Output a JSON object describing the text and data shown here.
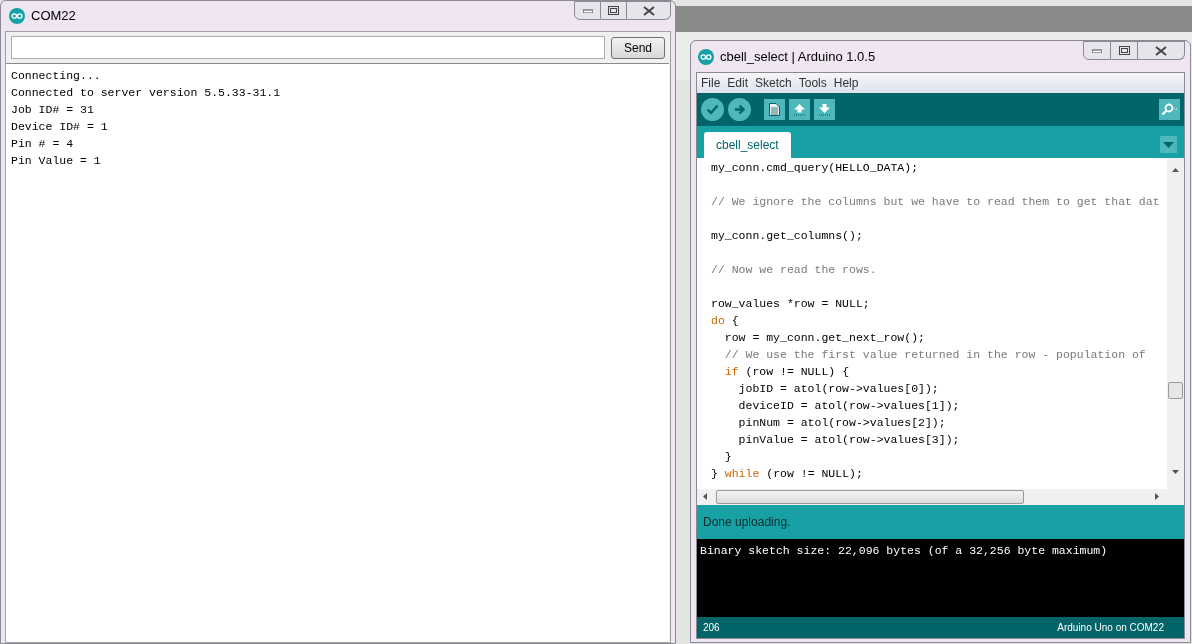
{
  "serial_monitor": {
    "title": "COM22",
    "send_button": "Send",
    "output_lines": [
      "Connecting...",
      "Connected to server version 5.5.33-31.1",
      "Job ID# = 31",
      "Device ID# = 1",
      "Pin # = 4",
      "Pin Value = 1"
    ]
  },
  "ide": {
    "title": "cbell_select | Arduino 1.0.5",
    "menu": [
      "File",
      "Edit",
      "Sketch",
      "Tools",
      "Help"
    ],
    "tabs": [
      {
        "label": "cbell_select",
        "selected": true
      }
    ],
    "code_lines": [
      {
        "kind": "code",
        "segments": [
          {
            "kind": "plain",
            "text": "my_conn.cmd_query(HELLO_DATA);"
          }
        ]
      },
      {
        "kind": "blank"
      },
      {
        "kind": "code",
        "segments": [
          {
            "kind": "comment",
            "text": "// We ignore the columns but we have to read them to get that dat"
          }
        ]
      },
      {
        "kind": "blank"
      },
      {
        "kind": "code",
        "segments": [
          {
            "kind": "plain",
            "text": "my_conn.get_columns();"
          }
        ]
      },
      {
        "kind": "blank"
      },
      {
        "kind": "code",
        "segments": [
          {
            "kind": "comment",
            "text": "// Now we read the rows."
          }
        ]
      },
      {
        "kind": "blank"
      },
      {
        "kind": "code",
        "segments": [
          {
            "kind": "plain",
            "text": "row_values *row = NULL;"
          }
        ]
      },
      {
        "kind": "code",
        "segments": [
          {
            "kind": "keyword",
            "text": "do"
          },
          {
            "kind": "plain",
            "text": " {"
          }
        ]
      },
      {
        "kind": "code",
        "segments": [
          {
            "kind": "plain",
            "text": "  row = my_conn.get_next_row();"
          }
        ]
      },
      {
        "kind": "code",
        "segments": [
          {
            "kind": "comment",
            "text": "  // We use the first value returned in the row - population of"
          }
        ]
      },
      {
        "kind": "code",
        "segments": [
          {
            "kind": "keyword",
            "text": "  if"
          },
          {
            "kind": "plain",
            "text": " (row != NULL) {"
          }
        ]
      },
      {
        "kind": "code",
        "segments": [
          {
            "kind": "plain",
            "text": "    jobID = atol(row->values[0]);"
          }
        ]
      },
      {
        "kind": "code",
        "segments": [
          {
            "kind": "plain",
            "text": "    deviceID = atol(row->values[1]);"
          }
        ]
      },
      {
        "kind": "code",
        "segments": [
          {
            "kind": "plain",
            "text": "    pinNum = atol(row->values[2]);"
          }
        ]
      },
      {
        "kind": "code",
        "segments": [
          {
            "kind": "plain",
            "text": "    pinValue = atol(row->values[3]);"
          }
        ]
      },
      {
        "kind": "code",
        "segments": [
          {
            "kind": "plain",
            "text": "  }"
          }
        ]
      },
      {
        "kind": "code",
        "segments": [
          {
            "kind": "plain",
            "text": "} "
          },
          {
            "kind": "keyword",
            "text": "while"
          },
          {
            "kind": "plain",
            "text": " (row != NULL);"
          }
        ]
      }
    ],
    "status_message": "Done uploading.",
    "console_lines": [
      "Binary sketch size: 22,096 bytes (of a 32,256 byte maximum)"
    ],
    "line_number": "206",
    "board": "Arduino Uno on COM22"
  }
}
